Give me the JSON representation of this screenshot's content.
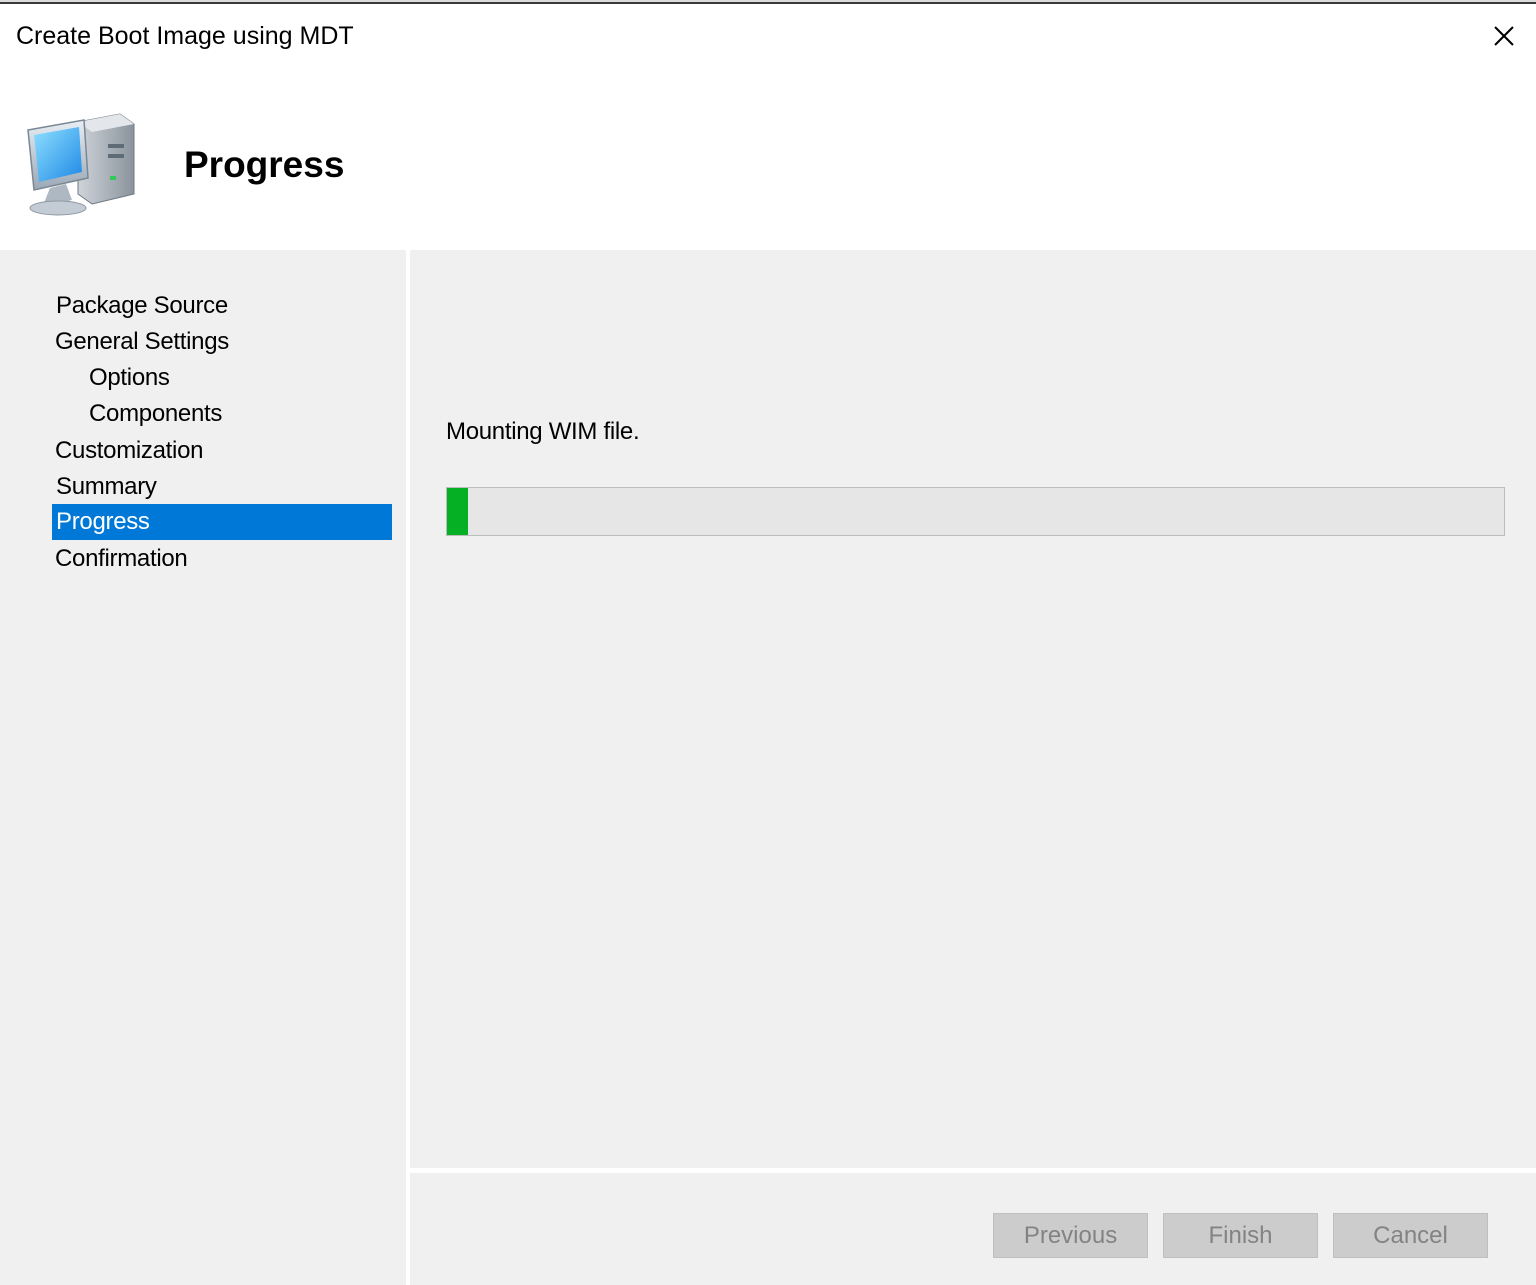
{
  "window": {
    "title": "Create Boot Image using MDT",
    "close_icon": "close-icon"
  },
  "header": {
    "title": "Progress",
    "icon": "computer-icon"
  },
  "sidebar": {
    "items": [
      {
        "label": "Package Source",
        "indent": false,
        "active": false
      },
      {
        "label": "General Settings",
        "indent": false,
        "active": false
      },
      {
        "label": "Options",
        "indent": true,
        "active": false
      },
      {
        "label": "Components",
        "indent": true,
        "active": false
      },
      {
        "label": "Customization",
        "indent": false,
        "active": false
      },
      {
        "label": "Summary",
        "indent": false,
        "active": false
      },
      {
        "label": "Progress",
        "indent": false,
        "active": true
      },
      {
        "label": "Confirmation",
        "indent": false,
        "active": false
      }
    ]
  },
  "main": {
    "status": "Mounting WIM file.",
    "progress_fraction": 0.02,
    "progress_color": "#06b025"
  },
  "footer": {
    "previous_label": "Previous",
    "finish_label": "Finish",
    "cancel_label": "Cancel",
    "buttons_enabled": false
  },
  "colors": {
    "accent": "#0078d7",
    "panel": "#f0f0f0"
  }
}
